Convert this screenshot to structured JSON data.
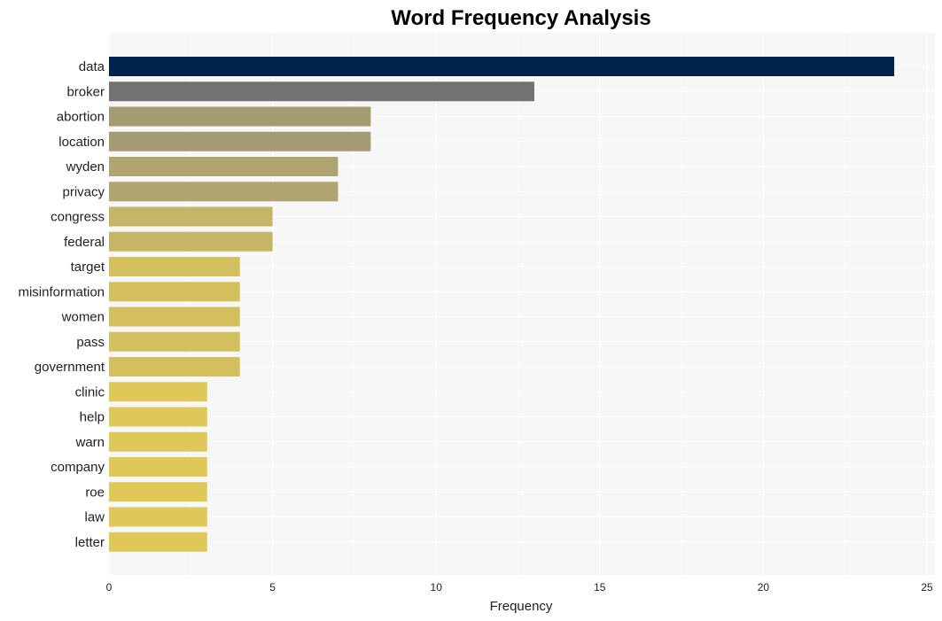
{
  "chart_data": {
    "type": "bar",
    "orientation": "horizontal",
    "title": "Word Frequency Analysis",
    "xlabel": "Frequency",
    "ylabel": "",
    "xlim": [
      0,
      25
    ],
    "xticks": [
      0,
      5,
      10,
      15,
      20,
      25
    ],
    "grid": true,
    "legend": "none",
    "categories": [
      "data",
      "broker",
      "abortion",
      "location",
      "wyden",
      "privacy",
      "congress",
      "federal",
      "target",
      "misinformation",
      "women",
      "pass",
      "government",
      "clinic",
      "help",
      "warn",
      "company",
      "roe",
      "law",
      "letter"
    ],
    "values": [
      24,
      13,
      8,
      8,
      7,
      7,
      5,
      5,
      4,
      4,
      4,
      4,
      4,
      3,
      3,
      3,
      3,
      3,
      3,
      3
    ],
    "colors": [
      "#00224e",
      "#727272",
      "#a59b72",
      "#a59b72",
      "#b0a470",
      "#b0a470",
      "#c6b566",
      "#c6b566",
      "#d4bf5e",
      "#d4bf5e",
      "#d4bf5e",
      "#d4bf5e",
      "#d4bf5e",
      "#dfc858",
      "#dfc858",
      "#dfc858",
      "#dfc858",
      "#dfc858",
      "#dfc858",
      "#dfc858"
    ]
  },
  "style": {
    "plot_background": "#f7f7f7",
    "grid_color": "#ffffff"
  }
}
